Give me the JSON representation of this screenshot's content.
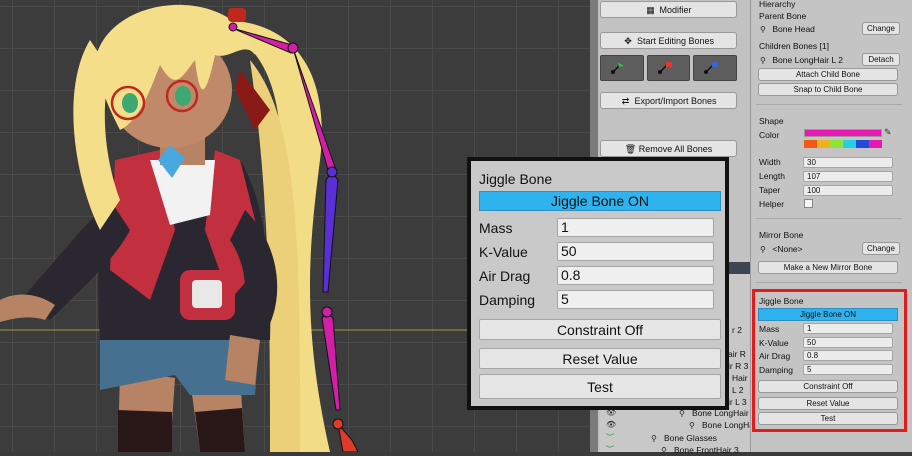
{
  "colors": {
    "accent_blue": "#2fb3ee",
    "highlight_red": "#e21c1c",
    "shape_color": "#e619b0",
    "bone_purple": "#5a2fd6",
    "bone_magenta": "#d21ea8",
    "bone_red": "#e23a2a",
    "palette": [
      "#f05a16",
      "#f2b11a",
      "#8ee23a",
      "#24d0e6",
      "#2448d8",
      "#e619b0"
    ]
  },
  "modifier_panel": {
    "modifier_button": "Modifier",
    "start_editing_button": "Start Editing Bones",
    "tool_icons": [
      "add-bone-icon",
      "delete-bone-icon",
      "move-bone-icon"
    ],
    "export_import_button": "Export/Import Bones",
    "remove_all_button": "Remove All Bones"
  },
  "hierarchy_list": {
    "items": [
      {
        "label": "r 2",
        "eye": true
      },
      {
        "label": "air R",
        "eye": false
      },
      {
        "label": "ir R 3",
        "eye": false
      },
      {
        "label": "Hair",
        "eye": false
      },
      {
        "label": "L 2",
        "eye": false
      },
      {
        "label": "ir L 3",
        "eye": false
      },
      {
        "label": "Bone LongHair L",
        "eye": true
      },
      {
        "label": "Bone LongHair",
        "eye": true
      },
      {
        "label": "Bone Glasses",
        "eye": true
      },
      {
        "label": "Bone FrontHair 3",
        "eye": true
      }
    ]
  },
  "inspector": {
    "hierarchy_heading": "Hierarchy",
    "parent_bone_label": "Parent Bone",
    "parent_bone_value": "Bone Head",
    "change_button": "Change",
    "children_label": "Children Bones [1]",
    "child_bone_value": "Bone LongHair L 2",
    "detach_button": "Detach",
    "attach_child_button": "Attach Child Bone",
    "snap_child_button": "Snap to Child Bone",
    "shape_heading": "Shape",
    "color_label": "Color",
    "width_label": "Width",
    "width_value": "30",
    "length_label": "Length",
    "length_value": "107",
    "taper_label": "Taper",
    "taper_value": "100",
    "helper_label": "Helper",
    "helper_checked": false,
    "mirror_heading": "Mirror Bone",
    "mirror_value": "<None>",
    "mirror_change_button": "Change",
    "new_mirror_button": "Make a New Mirror Bone"
  },
  "jiggle": {
    "heading": "Jiggle Bone",
    "toggle_button": "Jiggle Bone ON",
    "mass_label": "Mass",
    "mass_value": "1",
    "kvalue_label": "K-Value",
    "kvalue_value": "50",
    "airdrag_label": "Air Drag",
    "airdrag_value": "0.8",
    "damping_label": "Damping",
    "damping_value": "5",
    "constraint_button": "Constraint Off",
    "reset_button": "Reset Value",
    "test_button": "Test"
  }
}
